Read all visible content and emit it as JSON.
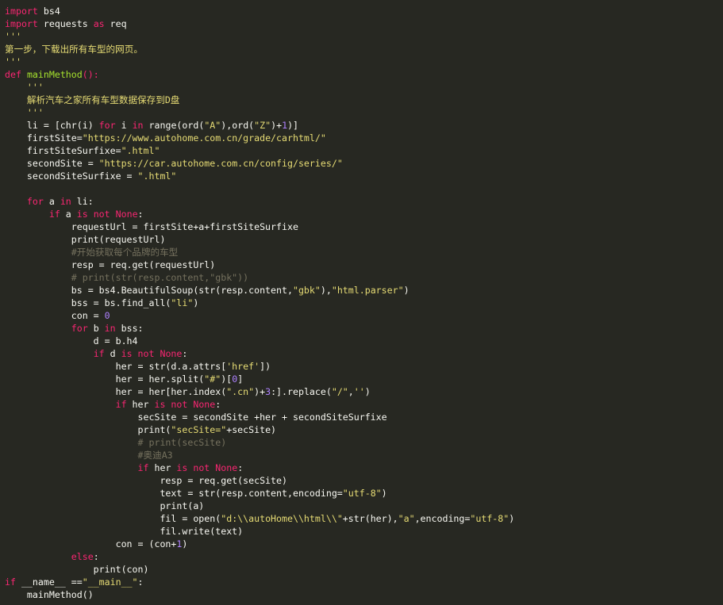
{
  "editor": {
    "language": "python",
    "theme_colors": {
      "background": "#272822",
      "text": "#f8f8f2",
      "keyword": "#f92672",
      "function": "#a6e22e",
      "string": "#e6db74",
      "number": "#ae81ff",
      "comment": "#75715e"
    },
    "lines": [
      [
        [
          "kw",
          "import"
        ],
        [
          "pl",
          " bs4"
        ]
      ],
      [
        [
          "kw",
          "import"
        ],
        [
          "pl",
          " requests "
        ],
        [
          "kw",
          "as"
        ],
        [
          "pl",
          " req"
        ]
      ],
      [
        [
          "st",
          "'''"
        ]
      ],
      [
        [
          "st",
          "第一步，下载出所有车型的网页。"
        ]
      ],
      [
        [
          "st",
          "'''"
        ]
      ],
      [
        [
          "kw",
          "def"
        ],
        [
          "pl",
          " "
        ],
        [
          "fn",
          "mainMethod"
        ],
        [
          "kw",
          "():"
        ]
      ],
      [
        [
          "pl",
          "    "
        ],
        [
          "st",
          "'''"
        ]
      ],
      [
        [
          "pl",
          "    "
        ],
        [
          "st",
          "解析汽车之家所有车型数据保存到D盘"
        ]
      ],
      [
        [
          "pl",
          "    "
        ],
        [
          "st",
          "'''"
        ]
      ],
      [
        [
          "pl",
          "    li = [chr(i) "
        ],
        [
          "kw",
          "for"
        ],
        [
          "pl",
          " i "
        ],
        [
          "kw",
          "in"
        ],
        [
          "pl",
          " range(ord("
        ],
        [
          "st",
          "\"A\""
        ],
        [
          "pl",
          "),ord("
        ],
        [
          "st",
          "\"Z\""
        ],
        [
          "pl",
          ")+"
        ],
        [
          "nm",
          "1"
        ],
        [
          "pl",
          ")]"
        ]
      ],
      [
        [
          "pl",
          "    firstSite="
        ],
        [
          "st",
          "\"https://www.autohome.com.cn/grade/carhtml/\""
        ]
      ],
      [
        [
          "pl",
          "    firstSiteSurfixe="
        ],
        [
          "st",
          "\".html\""
        ]
      ],
      [
        [
          "pl",
          "    secondSite = "
        ],
        [
          "st",
          "\"https://car.autohome.com.cn/config/series/\""
        ]
      ],
      [
        [
          "pl",
          "    secondSiteSurfixe = "
        ],
        [
          "st",
          "\".html\""
        ]
      ],
      [],
      [
        [
          "pl",
          "    "
        ],
        [
          "kw",
          "for"
        ],
        [
          "pl",
          " a "
        ],
        [
          "kw",
          "in"
        ],
        [
          "pl",
          " li:"
        ]
      ],
      [
        [
          "pl",
          "        "
        ],
        [
          "kw",
          "if"
        ],
        [
          "pl",
          " a "
        ],
        [
          "kw",
          "is not None"
        ],
        [
          "pl",
          ":"
        ]
      ],
      [
        [
          "pl",
          "            requestUrl = firstSite+a+firstSiteSurfixe"
        ]
      ],
      [
        [
          "pl",
          "            print(requestUrl)"
        ]
      ],
      [
        [
          "pl",
          "            "
        ],
        [
          "cm",
          "#开始获取每个品牌的车型"
        ]
      ],
      [
        [
          "pl",
          "            resp = req.get(requestUrl)"
        ]
      ],
      [
        [
          "pl",
          "            "
        ],
        [
          "cm",
          "# print(str(resp.content,\"gbk\"))"
        ]
      ],
      [
        [
          "pl",
          "            bs = bs4.BeautifulSoup(str(resp.content,"
        ],
        [
          "st",
          "\"gbk\""
        ],
        [
          "pl",
          "),"
        ],
        [
          "st",
          "\"html.parser\""
        ],
        [
          "pl",
          ")"
        ]
      ],
      [
        [
          "pl",
          "            bss = bs.find_all("
        ],
        [
          "st",
          "\"li\""
        ],
        [
          "pl",
          ")"
        ]
      ],
      [
        [
          "pl",
          "            con = "
        ],
        [
          "nm",
          "0"
        ]
      ],
      [
        [
          "pl",
          "            "
        ],
        [
          "kw",
          "for"
        ],
        [
          "pl",
          " b "
        ],
        [
          "kw",
          "in"
        ],
        [
          "pl",
          " bss:"
        ]
      ],
      [
        [
          "pl",
          "                d = b.h4"
        ]
      ],
      [
        [
          "pl",
          "                "
        ],
        [
          "kw",
          "if"
        ],
        [
          "pl",
          " d "
        ],
        [
          "kw",
          "is not None"
        ],
        [
          "pl",
          ":"
        ]
      ],
      [
        [
          "pl",
          "                    her = str(d.a.attrs["
        ],
        [
          "st",
          "'href'"
        ],
        [
          "pl",
          "])"
        ]
      ],
      [
        [
          "pl",
          "                    her = her.split("
        ],
        [
          "st",
          "\"#\""
        ],
        [
          "pl",
          ")["
        ],
        [
          "nm",
          "0"
        ],
        [
          "pl",
          "]"
        ]
      ],
      [
        [
          "pl",
          "                    her = her[her.index("
        ],
        [
          "st",
          "\".cn\""
        ],
        [
          "pl",
          ")+"
        ],
        [
          "nm",
          "3"
        ],
        [
          "pl",
          ":].replace("
        ],
        [
          "st",
          "\"/\""
        ],
        [
          "pl",
          ","
        ],
        [
          "st",
          "''"
        ],
        [
          "pl",
          ")"
        ]
      ],
      [
        [
          "pl",
          "                    "
        ],
        [
          "kw",
          "if"
        ],
        [
          "pl",
          " her "
        ],
        [
          "kw",
          "is not None"
        ],
        [
          "pl",
          ":"
        ]
      ],
      [
        [
          "pl",
          "                        secSite = secondSite +her + secondSiteSurfixe"
        ]
      ],
      [
        [
          "pl",
          "                        print("
        ],
        [
          "st",
          "\"secSite=\""
        ],
        [
          "pl",
          "+secSite)"
        ]
      ],
      [
        [
          "pl",
          "                        "
        ],
        [
          "cm",
          "# print(secSite)"
        ]
      ],
      [
        [
          "pl",
          "                        "
        ],
        [
          "cm",
          "#奥迪A3"
        ]
      ],
      [
        [
          "pl",
          "                        "
        ],
        [
          "kw",
          "if"
        ],
        [
          "pl",
          " her "
        ],
        [
          "kw",
          "is not None"
        ],
        [
          "pl",
          ":"
        ]
      ],
      [
        [
          "pl",
          "                            resp = req.get(secSite)"
        ]
      ],
      [
        [
          "pl",
          "                            text = str(resp.content,encoding="
        ],
        [
          "st",
          "\"utf-8\""
        ],
        [
          "pl",
          ")"
        ]
      ],
      [
        [
          "pl",
          "                            print(a)"
        ]
      ],
      [
        [
          "pl",
          "                            fil = open("
        ],
        [
          "st",
          "\"d:\\\\autoHome\\\\html\\\\\""
        ],
        [
          "pl",
          "+str(her),"
        ],
        [
          "st",
          "\"a\""
        ],
        [
          "pl",
          ",encoding="
        ],
        [
          "st",
          "\"utf-8\""
        ],
        [
          "pl",
          ")"
        ]
      ],
      [
        [
          "pl",
          "                            fil.write(text)"
        ]
      ],
      [
        [
          "pl",
          "                    con = (con+"
        ],
        [
          "nm",
          "1"
        ],
        [
          "pl",
          ")"
        ]
      ],
      [
        [
          "pl",
          "            "
        ],
        [
          "kw",
          "else"
        ],
        [
          "pl",
          ":"
        ]
      ],
      [
        [
          "pl",
          "                print(con)"
        ]
      ],
      [
        [
          "kw",
          "if"
        ],
        [
          "pl",
          " __name__ =="
        ],
        [
          "st",
          "\"__main__\""
        ],
        [
          "pl",
          ":"
        ]
      ],
      [
        [
          "pl",
          "    mainMethod()"
        ]
      ]
    ]
  }
}
